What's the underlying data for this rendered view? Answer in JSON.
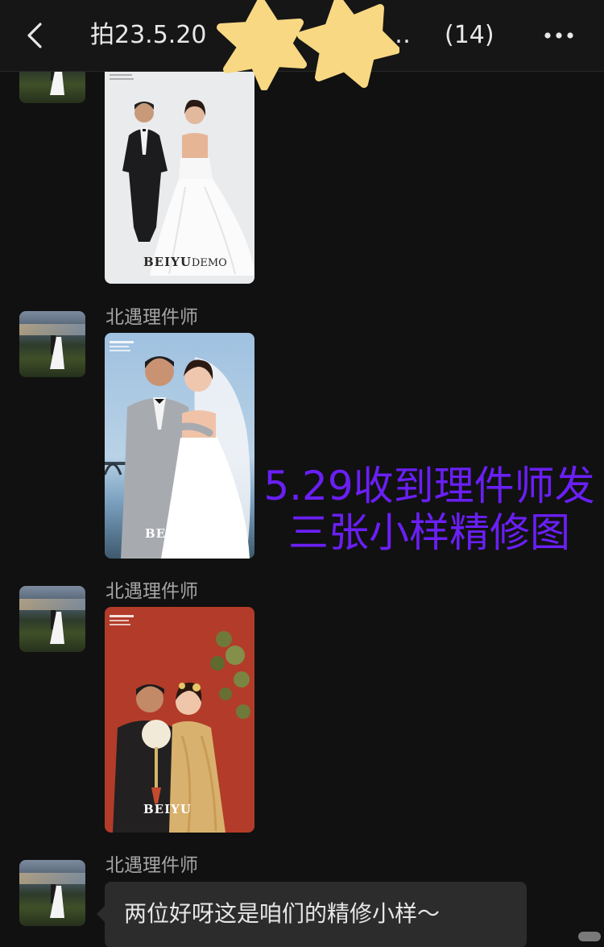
{
  "header": {
    "title": "拍23.5.20",
    "title_trailing": "…",
    "member_count": "(14)",
    "back_icon": "chevron-left-icon",
    "more_icon": "more-dots-icon",
    "redaction": "yellow-star-stickers"
  },
  "messages": [
    {
      "type": "image",
      "sender": "",
      "image_brand": "BEIYU",
      "image_brand_suffix": "DEMO",
      "scene": "white studio, suit and strapless wedding gown"
    },
    {
      "type": "image",
      "sender": "北遇理件师",
      "image_brand": "BEIYU",
      "scene": "seaside, grey suit and veil"
    },
    {
      "type": "image",
      "sender": "北遇理件师",
      "image_brand": "BEIYU",
      "scene": "red backdrop, traditional gold dress with round fan"
    },
    {
      "type": "text",
      "sender": "北遇理件师",
      "text": "两位好呀这是咱们的精修小样～"
    }
  ],
  "annotation": {
    "line1": "5.29收到理件师发",
    "line2": "三张小样精修图",
    "color": "#6a1ff5"
  },
  "colors": {
    "background": "#111111",
    "topbar": "#161616",
    "bubble": "#2c2c2c",
    "sender_text": "#a5a5a5"
  }
}
